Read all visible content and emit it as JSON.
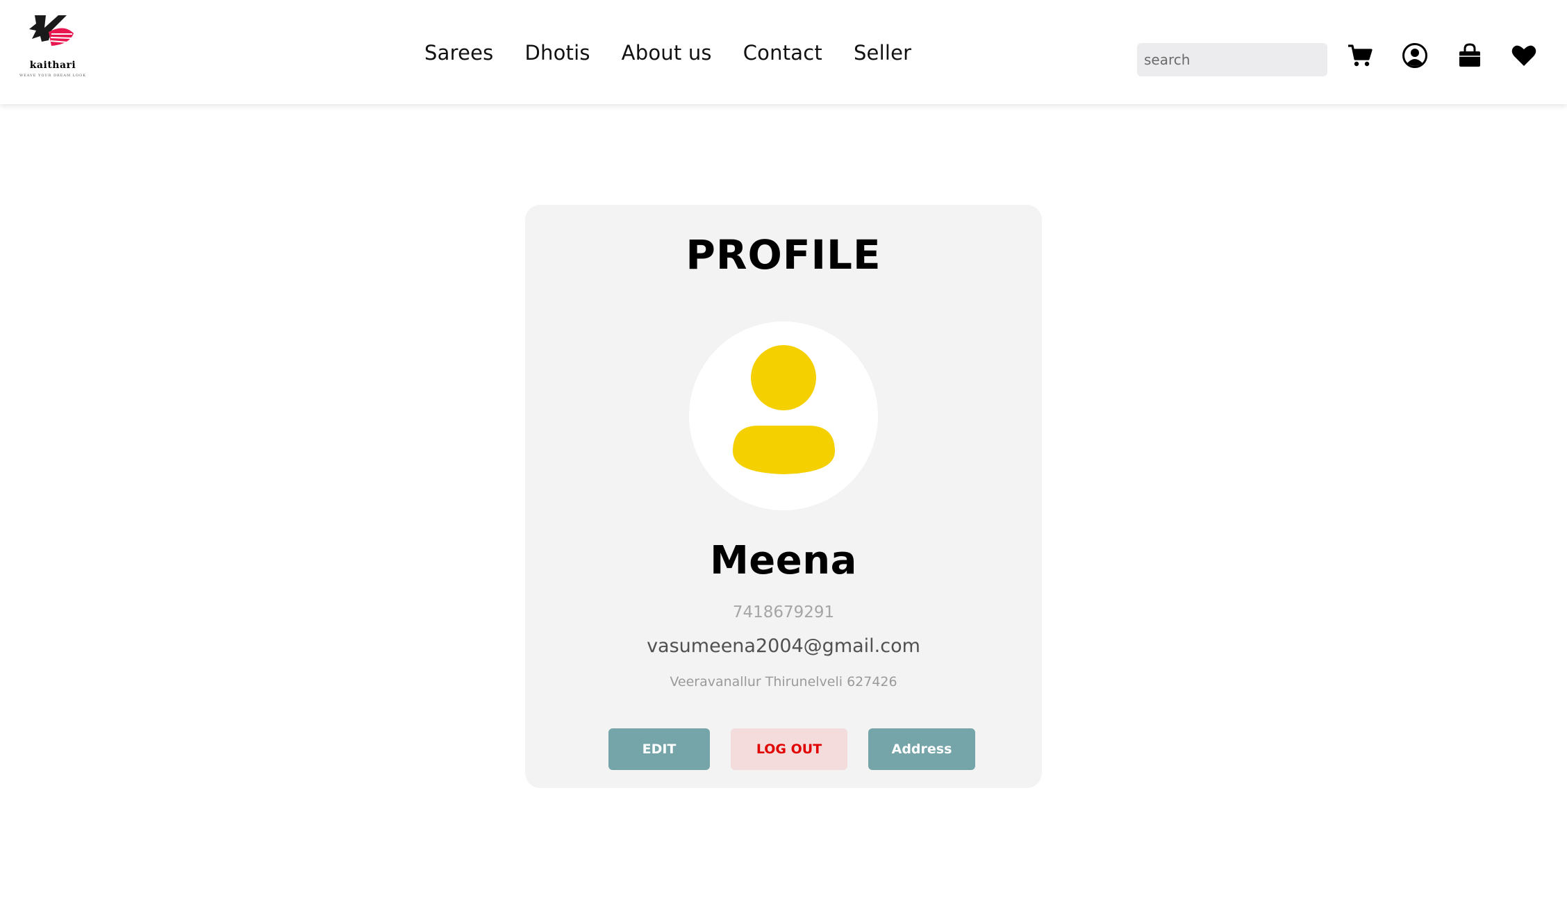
{
  "brand": {
    "name": "kaithari",
    "tagline": "WEAVE YOUR DREAM LOOK"
  },
  "nav": {
    "items": [
      {
        "label": "Sarees"
      },
      {
        "label": "Dhotis"
      },
      {
        "label": "About us"
      },
      {
        "label": "Contact"
      },
      {
        "label": "Seller"
      }
    ]
  },
  "search": {
    "placeholder": "search",
    "value": ""
  },
  "header_icons": [
    "cart-icon",
    "account-icon",
    "shopping-bag-icon",
    "heart-icon"
  ],
  "profile": {
    "title": "PROFILE",
    "name": "Meena",
    "phone": "7418679291",
    "email": "vasumeena2004@gmail.com",
    "address": "Veeravanallur Thirunelveli 627426",
    "avatar_color": "#f5d000",
    "buttons": {
      "edit": "EDIT",
      "logout": "LOG OUT",
      "address": "Address"
    }
  },
  "colors": {
    "accent_teal": "#75a5a8",
    "logout_bg": "#f4dcdc",
    "logout_text": "#e00000",
    "card_bg": "#f3f3f3",
    "logo_accent": "#e8174f"
  }
}
